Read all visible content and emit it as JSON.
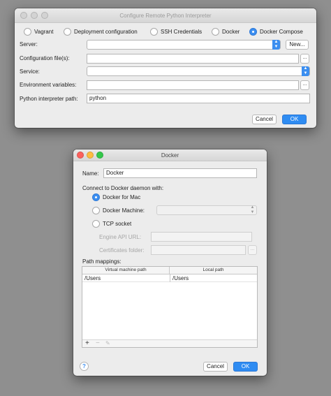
{
  "back_window": {
    "title": "Configure Remote Python Interpreter",
    "radio_options": [
      {
        "label": "Vagrant",
        "selected": false
      },
      {
        "label": "Deployment configuration",
        "selected": false
      },
      {
        "label": "SSH Credentials",
        "selected": false
      },
      {
        "label": "Docker",
        "selected": false
      },
      {
        "label": "Docker Compose",
        "selected": true
      }
    ],
    "server_label": "Server:",
    "server_value": "",
    "new_button": "New...",
    "config_files_label": "Configuration file(s):",
    "config_files_value": "",
    "browse_button": "...",
    "service_label": "Service:",
    "service_value": "",
    "env_vars_label": "Environment variables:",
    "env_vars_value": "",
    "interpreter_path_label": "Python interpreter path:",
    "interpreter_path_value": "python",
    "cancel_button": "Cancel",
    "ok_button": "OK"
  },
  "docker_dialog": {
    "title": "Docker",
    "name_label": "Name:",
    "name_value": "Docker",
    "connect_label": "Connect to Docker daemon with:",
    "options": {
      "docker_for_mac": {
        "label": "Docker for Mac",
        "selected": true
      },
      "docker_machine": {
        "label": "Docker Machine:",
        "selected": false,
        "value": ""
      },
      "tcp_socket": {
        "label": "TCP socket",
        "selected": false
      }
    },
    "engine_api_url_label": "Engine API URL:",
    "engine_api_url_value": "",
    "certificates_folder_label": "Certificates folder:",
    "certificates_folder_value": "",
    "browse_button": "...",
    "path_mappings_label": "Path mappings:",
    "path_mappings": {
      "columns": [
        "Virtual machine path",
        "Local path"
      ],
      "rows": [
        [
          "/Users",
          "/Users"
        ]
      ]
    },
    "toolbar": {
      "add": "+",
      "remove": "−",
      "edit": "✎"
    },
    "help_button": "?",
    "cancel_button": "Cancel",
    "ok_button": "OK"
  },
  "colors": {
    "accent": "#3b8ef0",
    "background": "#8f8f8f",
    "window": "#ececec"
  }
}
